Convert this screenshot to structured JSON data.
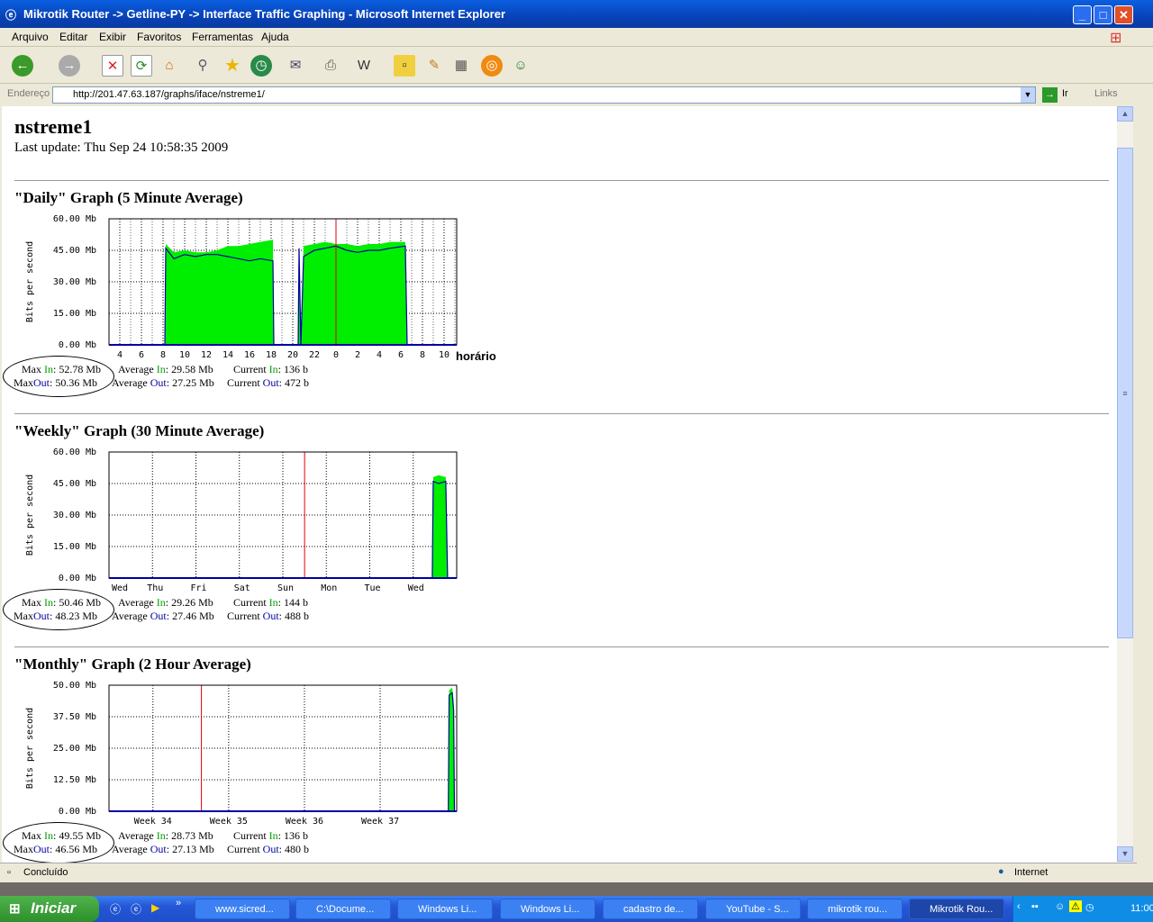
{
  "window": {
    "title": "Mikrotik Router -> Getline-PY -> Interface Traffic Graphing - Microsoft Internet Explorer",
    "min": "_",
    "max": "□",
    "close": "✕"
  },
  "menu": [
    "Arquivo",
    "Editar",
    "Exibir",
    "Favoritos",
    "Ferramentas",
    "Ajuda"
  ],
  "toolbar": {
    "icons": [
      "back-icon",
      "forward-icon",
      "stop-icon",
      "refresh-icon",
      "home-icon",
      "search-icon",
      "favorites-icon",
      "history-icon",
      "mail-icon",
      "print-icon",
      "edit-icon",
      "discuss-icon",
      "research-icon",
      "messenger-icon"
    ]
  },
  "address": {
    "label": "Endereço",
    "url": "http://201.47.63.187/graphs/iface/nstreme1/",
    "go": "Ir",
    "links": "Links"
  },
  "page": {
    "title": "nstreme1",
    "last_update": "Last update: Thu Sep 24 10:58:35 2009"
  },
  "graphs": [
    {
      "title": "\"Daily\" Graph (5 Minute Average)",
      "extra_label": "horário",
      "stats": {
        "max_in": "52.78 Mb",
        "avg_in": "29.58 Mb",
        "cur_in": "136 b",
        "max_out": "50.36 Mb",
        "avg_out": "27.25 Mb",
        "cur_out": "472 b"
      }
    },
    {
      "title": "\"Weekly\" Graph (30 Minute Average)",
      "stats": {
        "max_in": "50.46 Mb",
        "avg_in": "29.26 Mb",
        "cur_in": "144 b",
        "max_out": "48.23 Mb",
        "avg_out": "27.46 Mb",
        "cur_out": "488 b"
      }
    },
    {
      "title": "\"Monthly\" Graph (2 Hour Average)",
      "stats": {
        "max_in": "49.55 Mb",
        "avg_in": "28.73 Mb",
        "cur_in": "136 b",
        "max_out": "46.56 Mb",
        "avg_out": "27.13 Mb",
        "cur_out": "480 b"
      }
    }
  ],
  "stat_labels": {
    "max": "Max",
    "average": "Average",
    "current": "Current",
    "in": "In",
    "out": "Out"
  },
  "chart_data": [
    {
      "type": "area",
      "ylabel": "Bits per second",
      "yticks": [
        "0.00 Mb",
        "15.00 Mb",
        "30.00 Mb",
        "45.00 Mb",
        "60.00 Mb"
      ],
      "ylim": [
        0,
        60
      ],
      "xlim": [
        "2009-09-23 03:00",
        "2009-09-24 11:10"
      ],
      "xticks": [
        {
          "x": "2009-09-23 04:00",
          "label": "4"
        },
        {
          "x": "2009-09-23 06:00",
          "label": "6"
        },
        {
          "x": "2009-09-23 08:00",
          "label": "8"
        },
        {
          "x": "2009-09-23 10:00",
          "label": "10"
        },
        {
          "x": "2009-09-23 12:00",
          "label": "12"
        },
        {
          "x": "2009-09-23 14:00",
          "label": "14"
        },
        {
          "x": "2009-09-23 16:00",
          "label": "16"
        },
        {
          "x": "2009-09-23 18:00",
          "label": "18"
        },
        {
          "x": "2009-09-23 20:00",
          "label": "20"
        },
        {
          "x": "2009-09-23 22:00",
          "label": "22"
        },
        {
          "x": "2009-09-24 00:00",
          "label": "0"
        },
        {
          "x": "2009-09-24 02:00",
          "label": "2"
        },
        {
          "x": "2009-09-24 04:00",
          "label": "4"
        },
        {
          "x": "2009-09-24 06:00",
          "label": "6"
        },
        {
          "x": "2009-09-24 08:00",
          "label": "8"
        },
        {
          "x": "2009-09-24 10:00",
          "label": "10"
        }
      ],
      "grid": true,
      "marker": "2009-09-24 00:00",
      "series": [
        {
          "name": "In",
          "color": "#00ee00",
          "points": [
            [
              "2009-09-23 03:00",
              0
            ],
            [
              "2009-09-23 08:10",
              0
            ],
            [
              "2009-09-23 08:15",
              48
            ],
            [
              "2009-09-23 09:00",
              44
            ],
            [
              "2009-09-23 10:00",
              45
            ],
            [
              "2009-09-23 11:00",
              44
            ],
            [
              "2009-09-23 12:00",
              44
            ],
            [
              "2009-09-23 13:00",
              45
            ],
            [
              "2009-09-23 14:00",
              47
            ],
            [
              "2009-09-23 15:00",
              47
            ],
            [
              "2009-09-23 16:00",
              48
            ],
            [
              "2009-09-23 17:00",
              49
            ],
            [
              "2009-09-23 18:10",
              50
            ],
            [
              "2009-09-23 18:15",
              0
            ],
            [
              "2009-09-23 20:30",
              0
            ],
            [
              "2009-09-23 20:35",
              47
            ],
            [
              "2009-09-23 20:45",
              0
            ],
            [
              "2009-09-23 21:00",
              47
            ],
            [
              "2009-09-23 22:00",
              48
            ],
            [
              "2009-09-23 23:00",
              49
            ],
            [
              "2009-09-24 00:00",
              48
            ],
            [
              "2009-09-24 01:00",
              48
            ],
            [
              "2009-09-24 02:00",
              47
            ],
            [
              "2009-09-24 03:00",
              48
            ],
            [
              "2009-09-24 04:00",
              48
            ],
            [
              "2009-09-24 05:00",
              49
            ],
            [
              "2009-09-24 06:25",
              49
            ],
            [
              "2009-09-24 06:35",
              0
            ],
            [
              "2009-09-24 11:10",
              0
            ]
          ]
        },
        {
          "name": "Out",
          "color": "#0000a0",
          "points": [
            [
              "2009-09-23 03:00",
              0
            ],
            [
              "2009-09-23 08:10",
              0
            ],
            [
              "2009-09-23 08:15",
              46
            ],
            [
              "2009-09-23 09:00",
              41
            ],
            [
              "2009-09-23 10:00",
              43
            ],
            [
              "2009-09-23 11:00",
              42
            ],
            [
              "2009-09-23 12:00",
              43
            ],
            [
              "2009-09-23 13:00",
              43
            ],
            [
              "2009-09-23 14:00",
              42
            ],
            [
              "2009-09-23 15:00",
              41
            ],
            [
              "2009-09-23 16:00",
              40
            ],
            [
              "2009-09-23 17:00",
              41
            ],
            [
              "2009-09-23 18:10",
              40
            ],
            [
              "2009-09-23 18:15",
              0
            ],
            [
              "2009-09-23 20:30",
              0
            ],
            [
              "2009-09-23 20:35",
              46
            ],
            [
              "2009-09-23 20:45",
              0
            ],
            [
              "2009-09-23 21:00",
              42
            ],
            [
              "2009-09-23 22:00",
              45
            ],
            [
              "2009-09-23 23:00",
              46
            ],
            [
              "2009-09-24 00:00",
              47
            ],
            [
              "2009-09-24 01:00",
              45
            ],
            [
              "2009-09-24 02:00",
              44
            ],
            [
              "2009-09-24 03:00",
              45
            ],
            [
              "2009-09-24 04:00",
              45
            ],
            [
              "2009-09-24 05:00",
              46
            ],
            [
              "2009-09-24 06:25",
              47
            ],
            [
              "2009-09-24 06:35",
              0
            ],
            [
              "2009-09-24 11:10",
              0
            ]
          ]
        }
      ]
    },
    {
      "type": "area",
      "ylabel": "Bits per second",
      "yticks": [
        "0.00 Mb",
        "15.00 Mb",
        "30.00 Mb",
        "45.00 Mb",
        "60.00 Mb"
      ],
      "ylim": [
        0,
        60
      ],
      "xlim": [
        "2009-09-16 00:00",
        "2009-09-24 00:00"
      ],
      "xticks": [
        {
          "x": "2009-09-16 00:00",
          "label": "Wed"
        },
        {
          "x": "2009-09-17 00:00",
          "label": "Thu"
        },
        {
          "x": "2009-09-18 00:00",
          "label": "Fri"
        },
        {
          "x": "2009-09-19 00:00",
          "label": "Sat"
        },
        {
          "x": "2009-09-20 00:00",
          "label": "Sun"
        },
        {
          "x": "2009-09-21 00:00",
          "label": "Mon"
        },
        {
          "x": "2009-09-22 00:00",
          "label": "Tue"
        },
        {
          "x": "2009-09-23 00:00",
          "label": "Wed"
        }
      ],
      "grid": true,
      "marker": "2009-09-20 12:00",
      "series": [
        {
          "name": "In",
          "color": "#00ee00",
          "points": [
            [
              "2009-09-16 00:00",
              0
            ],
            [
              "2009-09-23 10:30",
              0
            ],
            [
              "2009-09-23 11:00",
              48
            ],
            [
              "2009-09-23 14:00",
              49
            ],
            [
              "2009-09-23 18:00",
              48
            ],
            [
              "2009-09-23 19:00",
              0
            ],
            [
              "2009-09-24 00:00",
              0
            ]
          ]
        },
        {
          "name": "Out",
          "color": "#0000a0",
          "points": [
            [
              "2009-09-16 00:00",
              0
            ],
            [
              "2009-09-23 10:30",
              0
            ],
            [
              "2009-09-23 11:00",
              46
            ],
            [
              "2009-09-23 14:00",
              45
            ],
            [
              "2009-09-23 18:00",
              46
            ],
            [
              "2009-09-23 19:00",
              0
            ],
            [
              "2009-09-24 00:00",
              0
            ]
          ]
        }
      ]
    },
    {
      "type": "area",
      "ylabel": "Bits per second",
      "yticks": [
        "0.00 Mb",
        "12.50 Mb",
        "25.00 Mb",
        "37.50 Mb",
        "50.00 Mb"
      ],
      "ylim": [
        0,
        50
      ],
      "xlim": [
        33.42,
        38.01
      ],
      "xticks": [
        {
          "x": 34,
          "label": "Week 34"
        },
        {
          "x": 35,
          "label": "Week 35"
        },
        {
          "x": 36,
          "label": "Week 36"
        },
        {
          "x": 37,
          "label": "Week 37"
        }
      ],
      "grid": true,
      "marker": 34.64,
      "series": [
        {
          "name": "In",
          "color": "#00ee00",
          "points": [
            [
              33.42,
              0
            ],
            [
              37.9,
              0
            ],
            [
              37.91,
              48
            ],
            [
              37.95,
              49
            ],
            [
              37.97,
              44
            ],
            [
              37.98,
              0
            ],
            [
              38.01,
              0
            ]
          ]
        },
        {
          "name": "Out",
          "color": "#0000a0",
          "points": [
            [
              33.42,
              0
            ],
            [
              37.9,
              0
            ],
            [
              37.91,
              46
            ],
            [
              37.95,
              47
            ],
            [
              37.97,
              40
            ],
            [
              37.98,
              0
            ],
            [
              38.01,
              0
            ]
          ]
        }
      ]
    }
  ],
  "status": {
    "text": "Concluído",
    "zone": "Internet"
  },
  "taskbar": {
    "start": "Iniciar",
    "tasks": [
      "www.sicred...",
      "C:\\Docume...",
      "Windows Li...",
      "Windows Li...",
      "cadastro de...",
      "YouTube - S...",
      "mikrotik rou...",
      "Mikrotik Rou..."
    ],
    "clock": "11:00"
  }
}
